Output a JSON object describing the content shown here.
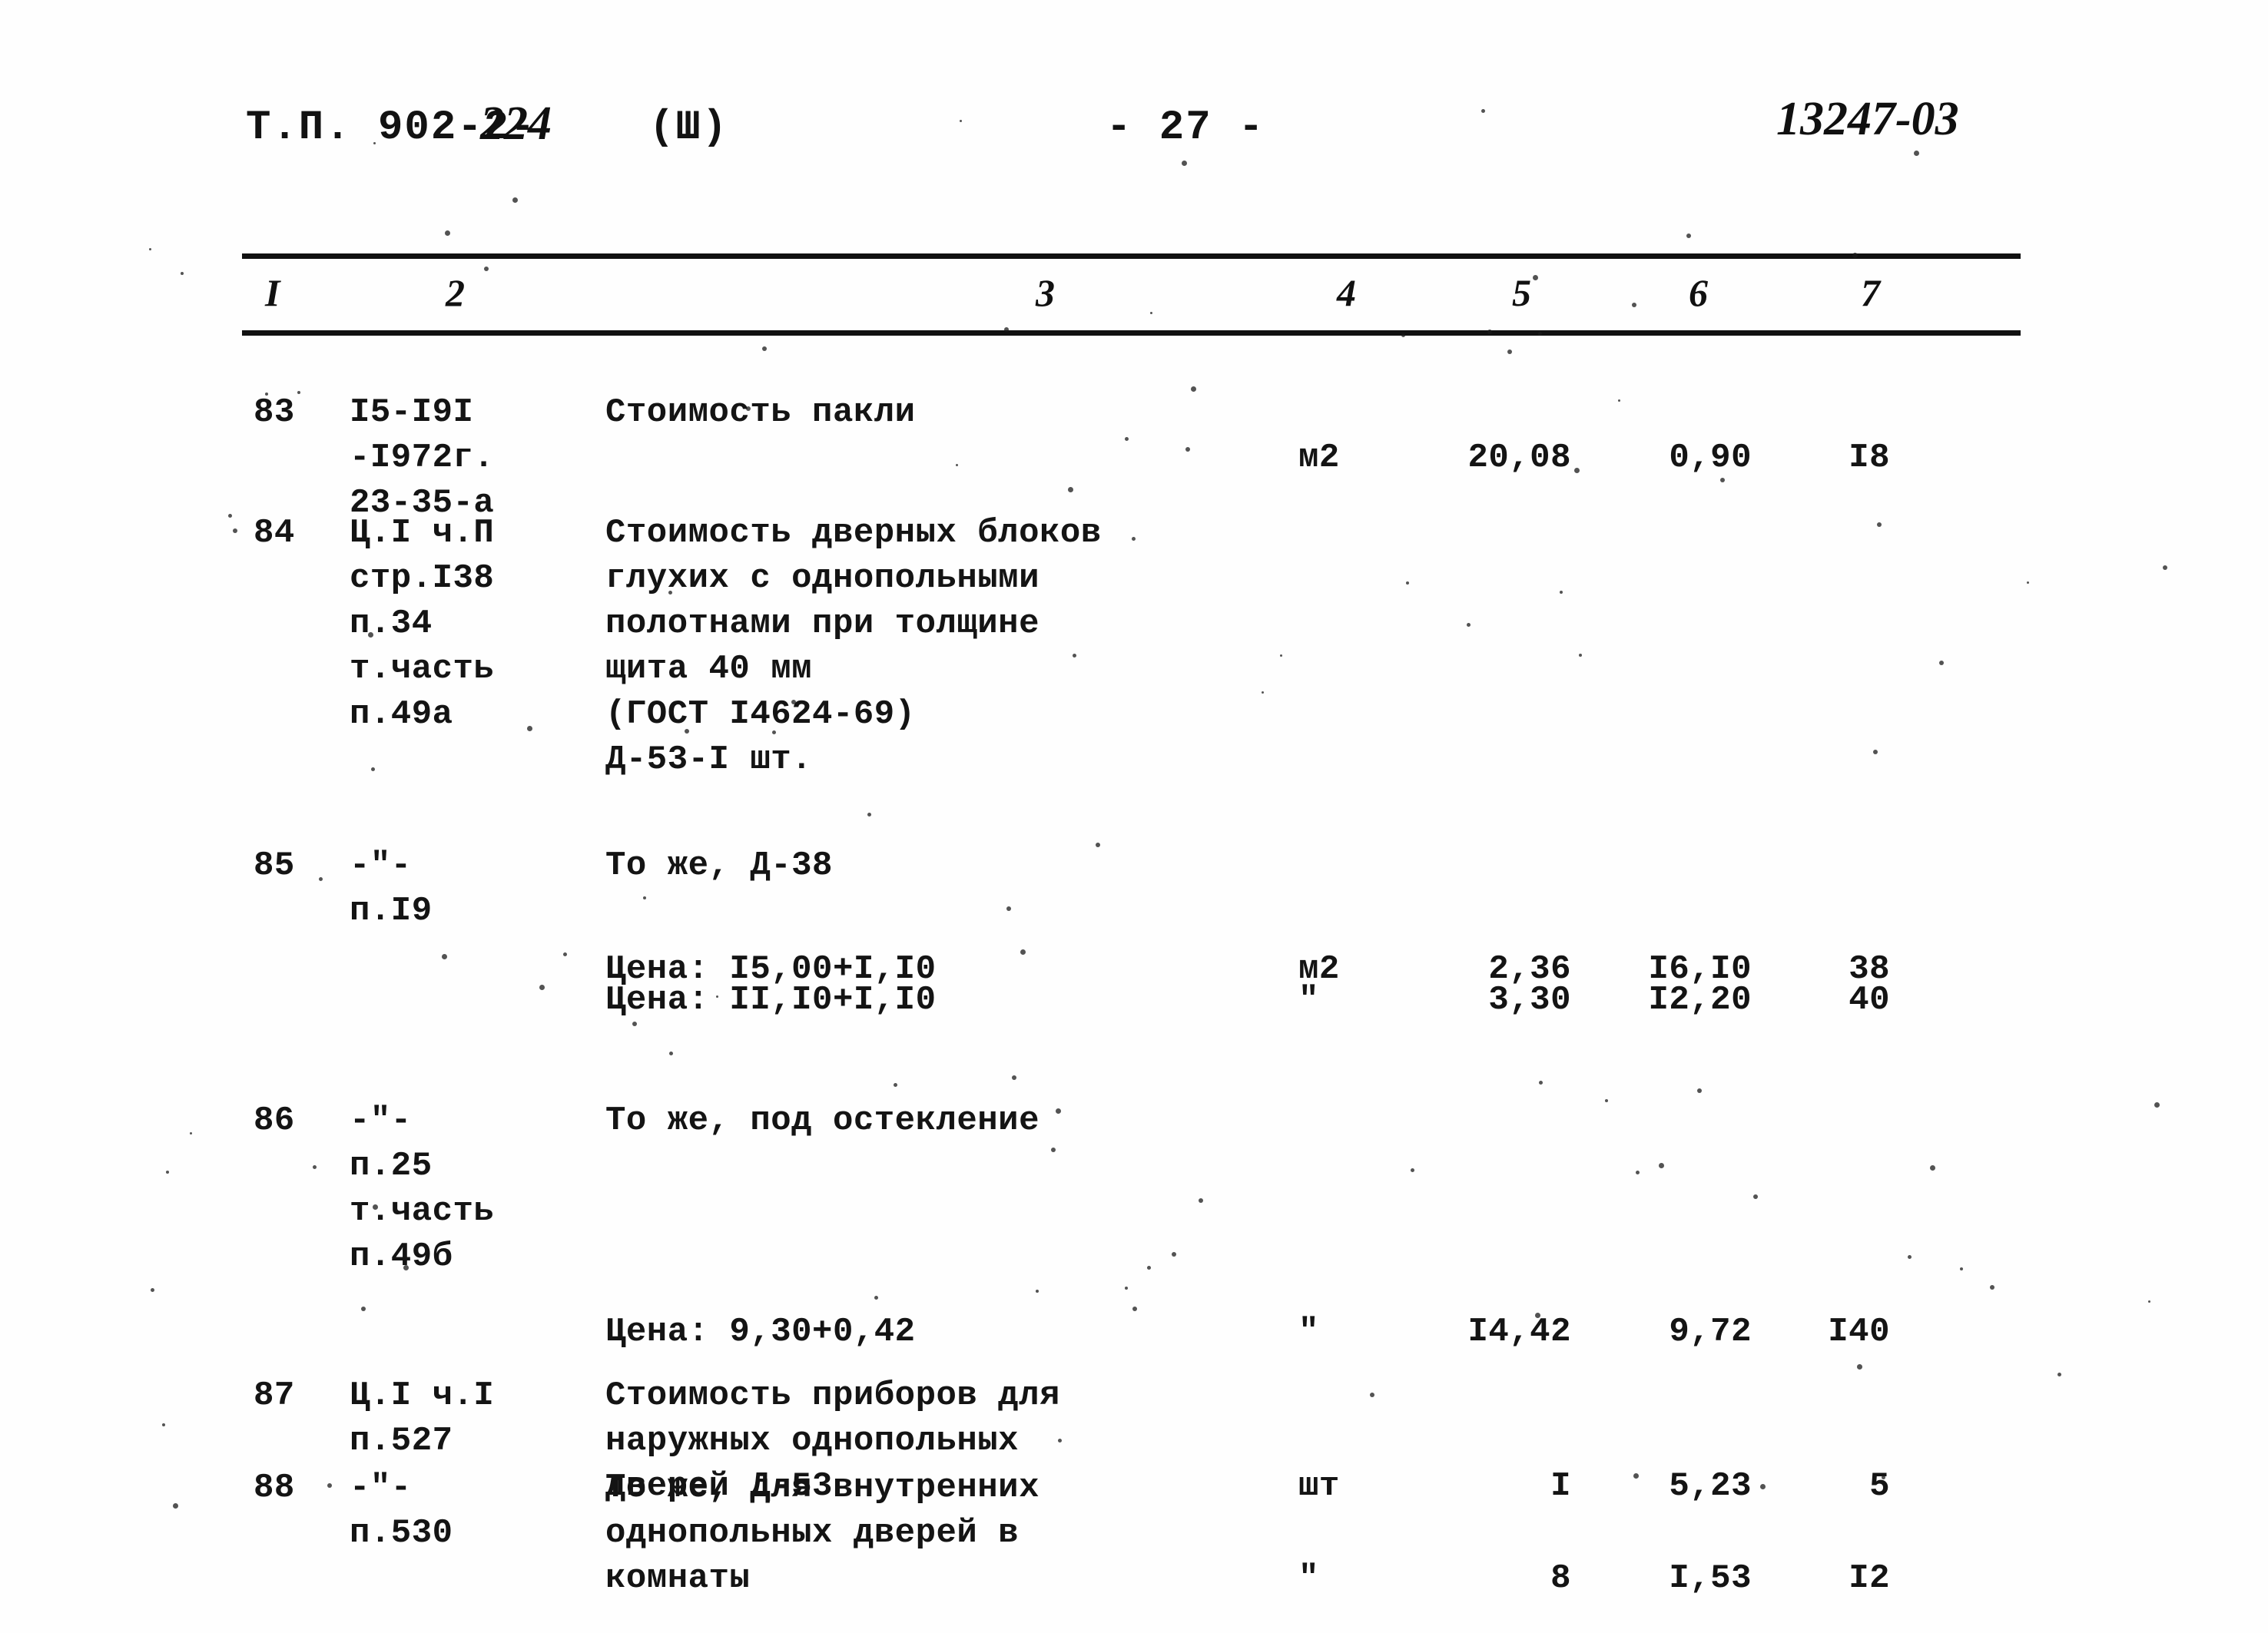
{
  "header": {
    "doc_code_typed": "Т.П. 902-2-",
    "doc_code_hand": "224",
    "series": "(Ш)",
    "page_number": "- 27 -",
    "archive_code": "13247-03"
  },
  "table": {
    "column_numbers": [
      "I",
      "2",
      "3",
      "4",
      "5",
      "6",
      "7"
    ],
    "rows": [
      {
        "no": "83",
        "ref_lines": [
          "I5-I9I",
          "-I972г.",
          "23-35-а"
        ],
        "desc_lines": [
          "Стоимость пакли"
        ],
        "unit": "м2",
        "qty": "20,08",
        "price": "0,90",
        "total": "I8"
      },
      {
        "no": "84",
        "ref_lines": [
          "Ц.I ч.П",
          "стр.I38",
          "п.34",
          "т.часть",
          "п.49а"
        ],
        "desc_lines": [
          "Стоимость дверных блоков",
          "глухих с однопольными",
          "полотнами при толщине",
          "щита 40 мм",
          "(ГОСТ I4624-69)",
          "Д-53-I шт."
        ],
        "unit": "",
        "qty": "",
        "price": "",
        "total": "",
        "sub": {
          "desc": "Цена: I5,00+I,I0",
          "unit": "м2",
          "qty": "2,36",
          "price": "I6,I0",
          "total": "38"
        }
      },
      {
        "no": "85",
        "ref_lines": [
          "-\"-",
          "п.I9"
        ],
        "desc_lines": [
          "То же, Д-38"
        ],
        "unit": "",
        "qty": "",
        "price": "",
        "total": "",
        "sub": {
          "desc": "Цена: II,I0+I,I0",
          "unit": "\"",
          "qty": "3,30",
          "price": "I2,20",
          "total": "40"
        }
      },
      {
        "no": "86",
        "ref_lines": [
          "-\"-",
          "п.25",
          "т.часть",
          "п.49б"
        ],
        "desc_lines": [
          "То же, под остекление"
        ],
        "unit": "",
        "qty": "",
        "price": "",
        "total": "",
        "sub": {
          "desc": "Цена: 9,30+0,42",
          "unit": "\"",
          "qty": "I4,42",
          "price": "9,72",
          "total": "I40"
        }
      },
      {
        "no": "87",
        "ref_lines": [
          "Ц.I ч.I",
          "п.527"
        ],
        "desc_lines": [
          "Стоимость приборов для",
          "наружных однопольных",
          "дверей Д-53"
        ],
        "unit": "шт",
        "qty": "I",
        "price": "5,23",
        "total": "5"
      },
      {
        "no": "88",
        "ref_lines": [
          "-\"-",
          "п.530"
        ],
        "desc_lines": [
          "То же, для внутренних",
          "однопольных дверей в",
          "комнаты"
        ],
        "unit": "\"",
        "qty": "8",
        "price": "I,53",
        "total": "I2"
      }
    ]
  }
}
